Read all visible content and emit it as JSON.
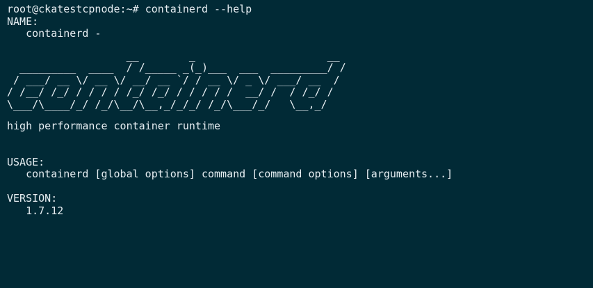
{
  "prompt": {
    "user_host": "root@ckatestcpnode:~#",
    "command": "containerd --help"
  },
  "name_section": {
    "header": "NAME:",
    "value": "   containerd -"
  },
  "banner": {
    "art": "                   __        _                     __\n  _________  ____  / /_____ _(_)___  ___  _________/ /\n / ___/ __ \\/ __ \\/ __/ __ `/ / __ \\/ _ \\/ ___/ __  /\n/ /__/ /_/ / / / / /_/ /_/ / / / / /  __/ /  / /_/ /\n\\___/\\____/_/ /_/\\__/\\__,_/_/_/ /_/\\___/_/   \\__,_/"
  },
  "description": "high performance container runtime",
  "usage_section": {
    "header": "USAGE:",
    "value": "   containerd [global options] command [command options] [arguments...]"
  },
  "version_section": {
    "header": "VERSION:",
    "value": "   1.7.12"
  },
  "colors": {
    "background": "#012a36",
    "foreground": "#e6eef2"
  }
}
